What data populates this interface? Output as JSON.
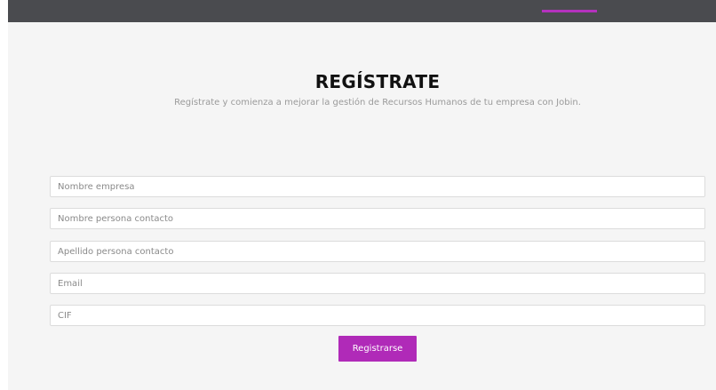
{
  "header": {
    "accent_color": "#b432bd"
  },
  "main": {
    "title": "REGÍSTRATE",
    "subtitle": "Regístrate y comienza a mejorar la gestión de Recursos Humanos de tu empresa con Jobin."
  },
  "form": {
    "fields": [
      {
        "placeholder": "Nombre empresa",
        "value": ""
      },
      {
        "placeholder": "Nombre persona contacto",
        "value": ""
      },
      {
        "placeholder": "Apellido persona contacto",
        "value": ""
      },
      {
        "placeholder": "Email",
        "value": ""
      },
      {
        "placeholder": "CIF",
        "value": ""
      }
    ],
    "submit_label": "Registrarse",
    "submit_color": "#b02ab8"
  }
}
